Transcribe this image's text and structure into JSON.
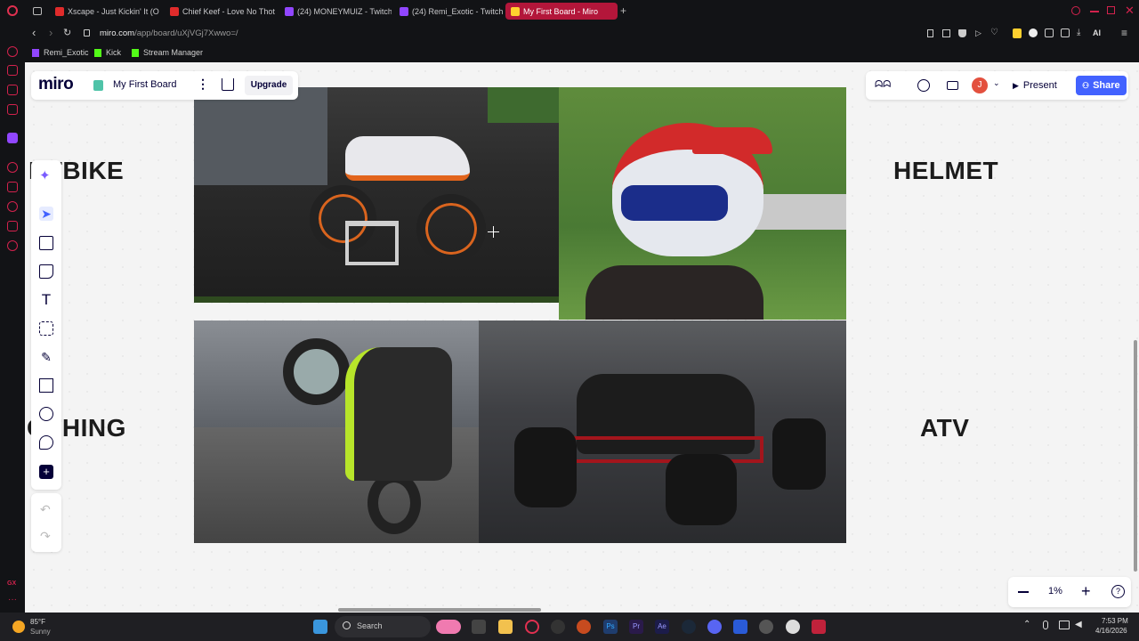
{
  "browser": {
    "tabs": [
      {
        "label": "Xscape - Just Kickin' It (O",
        "color": "#e02b2b"
      },
      {
        "label": "Chief Keef - Love No Thot",
        "color": "#e02b2b"
      },
      {
        "label": "(24) MONEYMUIZ - Twitch",
        "color": "#9146ff"
      },
      {
        "label": "(24) Remi_Exotic - Twitch",
        "color": "#9146ff"
      },
      {
        "label": "My First Board - Miro",
        "color": "#ffd02f"
      }
    ],
    "url_domain": "miro.com",
    "url_path": "/app/board/uXjVGj7Xwwo=/",
    "bookmarks": [
      {
        "label": "Remi_Exotic",
        "color": "#9146ff"
      },
      {
        "label": "Kick",
        "color": "#53fc18"
      },
      {
        "label": "Stream Manager",
        "color": "#53fc18"
      }
    ],
    "toolbar_ai_label": "AI"
  },
  "miro": {
    "logo": "miro",
    "board_title": "My First Board",
    "upgrade_label": "Upgrade",
    "present_label": "Present",
    "share_label": "Share",
    "avatar_initial": "J",
    "zoom_level": "1%",
    "accent_color": "#4262ff"
  },
  "board": {
    "words": {
      "dirtbike": "RTBIKE",
      "helmet": "HELMET",
      "clothing": "OTHING",
      "atv": "ATV"
    }
  },
  "taskbar": {
    "weather_temp": "85°F",
    "weather_desc": "Sunny",
    "search_placeholder": "Search",
    "time": "7:53 PM",
    "date": "4/16/2026"
  }
}
